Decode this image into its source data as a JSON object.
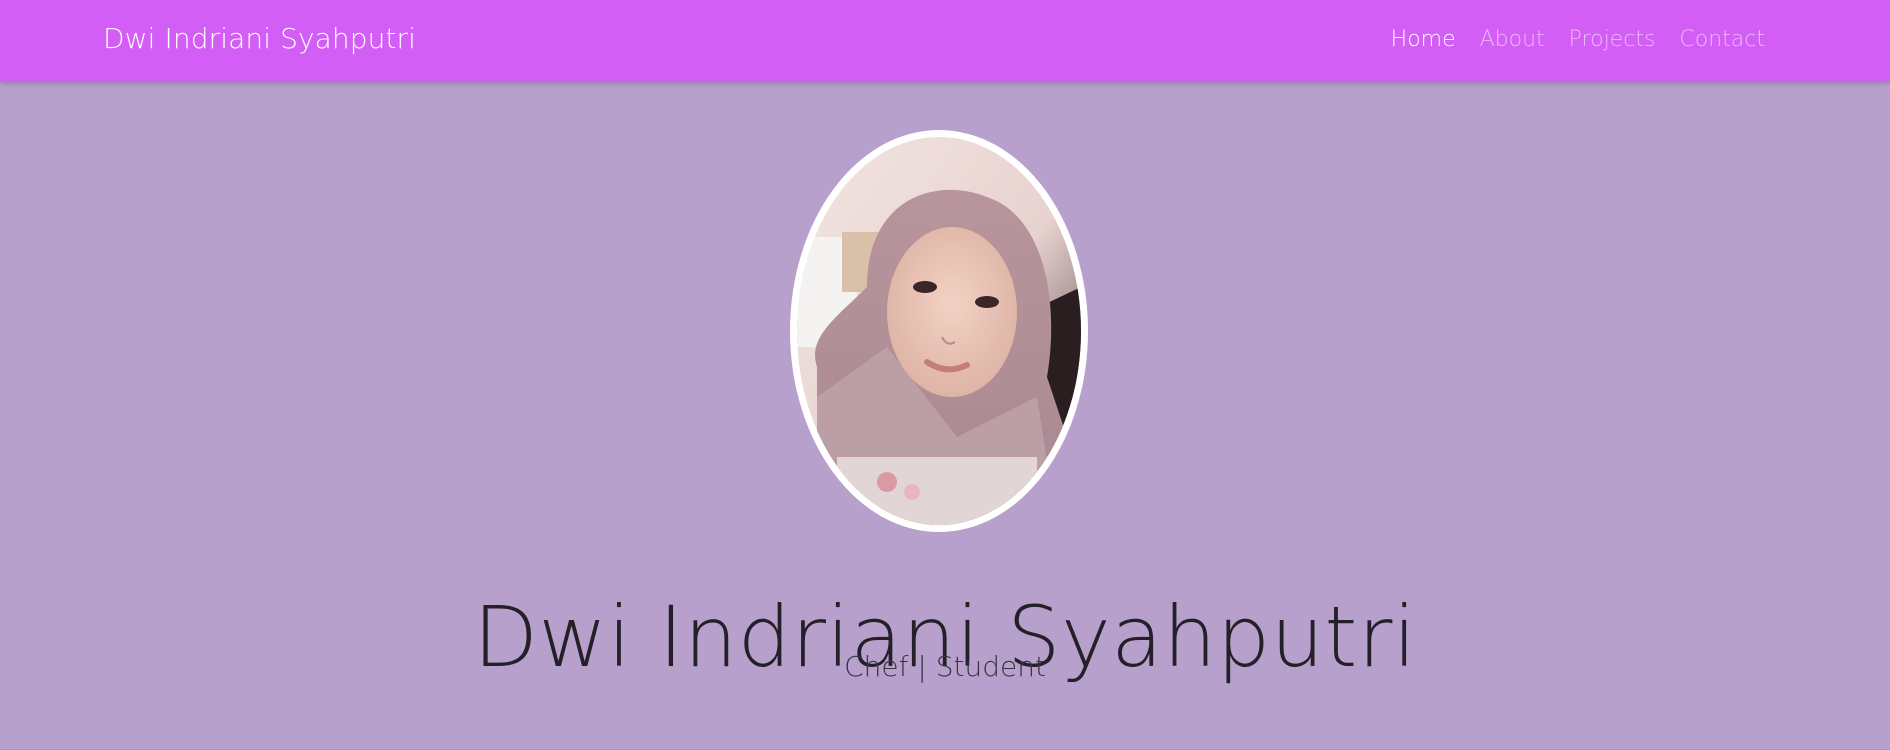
{
  "navbar": {
    "brand": "Dwi Indriani Syahputri",
    "links": [
      {
        "label": "Home",
        "active": true
      },
      {
        "label": "About",
        "active": false
      },
      {
        "label": "Projects",
        "active": false
      },
      {
        "label": "Contact",
        "active": false
      }
    ]
  },
  "hero": {
    "photo": "profile-photo",
    "name": "Dwi Indriani Syahputri",
    "subtitle": "Chef | Student"
  },
  "colors": {
    "navbar_bg": "#d35ef5",
    "page_bg": "#b8a0cc",
    "active_link": "#ffffff"
  }
}
